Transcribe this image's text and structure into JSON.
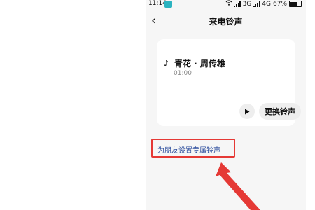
{
  "status_bar": {
    "time": "11:14",
    "network_1": "3G",
    "network_2": "4G",
    "battery": "67%"
  },
  "header": {
    "title": "来电铃声"
  },
  "ringtone": {
    "name": "青花 · 周传雄",
    "duration": "01:00",
    "change_label": "更换铃声"
  },
  "friend_link_label": "为朋友设置专属铃声",
  "colors": {
    "highlight": "#e53935",
    "link": "#2f4f9e",
    "screen_bg": "#f6f6f6"
  }
}
